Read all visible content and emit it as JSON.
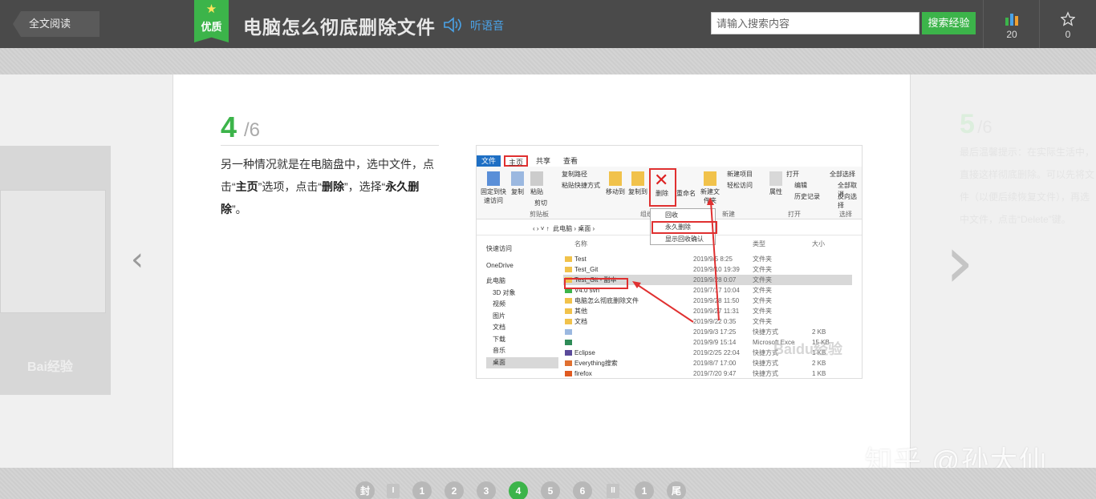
{
  "header": {
    "back_label": "全文阅读",
    "badge_label": "优质",
    "title": "电脑怎么彻底删除文件",
    "listen_label": "听语音",
    "search_placeholder": "请输入搜索内容",
    "search_button": "搜索经验",
    "stats_count": "20",
    "favorites_count": "0",
    "accent_color": "#3cb44a"
  },
  "step": {
    "current": "4",
    "total": "/6",
    "text_parts": [
      "另一种情况就是在电脑盘中，选中文件，点击“",
      "主页",
      "”选项，点击“",
      "删除",
      "”，选择“",
      "永久删除",
      "”。"
    ]
  },
  "screenshot": {
    "tabs": [
      "文件",
      "主页",
      "共享",
      "查看"
    ],
    "ribbon_buttons": [
      "固定到快速访问",
      "复制",
      "粘贴",
      "移动到",
      "复制到",
      "删除",
      "重命名",
      "新建文件夹",
      "属性",
      "打开",
      "全部选择"
    ],
    "ribbon_small": [
      "复制路径",
      "粘贴快捷方式",
      "剪切",
      "新建项目",
      "轻松访问",
      "编辑",
      "历史记录",
      "全部取消",
      "反向选择"
    ],
    "ribbon_groups": [
      "剪贴板",
      "组织",
      "新建",
      "打开",
      "选择"
    ],
    "delete_menu": [
      "回收",
      "永久删除",
      "显示回收确认"
    ],
    "address": [
      "此电脑",
      "桌面"
    ],
    "nav_items": [
      "快速访问",
      "OneDrive",
      "此电脑",
      "3D 对象",
      "视频",
      "图片",
      "文档",
      "下载",
      "音乐",
      "桌面"
    ],
    "columns": [
      "名称",
      "类型",
      "大小"
    ],
    "files": [
      {
        "name": "Test",
        "date": "2019/9/5 8:25",
        "type": "文件夹",
        "size": ""
      },
      {
        "name": "Test_Git",
        "date": "2019/9/10 19:39",
        "type": "文件夹",
        "size": ""
      },
      {
        "name": "Test_Git - 副本",
        "date": "2019/9/28 0:07",
        "type": "文件夹",
        "size": ""
      },
      {
        "name": "V4.0 svn",
        "date": "2019/7/17 10:04",
        "type": "文件夹",
        "size": ""
      },
      {
        "name": "电脑怎么彻底删除文件",
        "date": "2019/9/28 11:50",
        "type": "文件夹",
        "size": ""
      },
      {
        "name": "其他",
        "date": "2019/9/27 11:31",
        "type": "文件夹",
        "size": ""
      },
      {
        "name": "文档",
        "date": "2019/9/22 0:35",
        "type": "文件夹",
        "size": ""
      },
      {
        "name": "",
        "date": "2019/9/3 17:25",
        "type": "快捷方式",
        "size": "2 KB"
      },
      {
        "name": "",
        "date": "2019/9/9 15:14",
        "type": "Microsoft Exce",
        "size": "15 KB"
      },
      {
        "name": "Eclipse",
        "date": "2019/2/25 22:04",
        "type": "快捷方式",
        "size": "1 KB"
      },
      {
        "name": "Everything搜索",
        "date": "2019/8/7 17:00",
        "type": "快捷方式",
        "size": "2 KB"
      },
      {
        "name": "firefox",
        "date": "2019/7/20 9:47",
        "type": "快捷方式",
        "size": "1 KB"
      }
    ],
    "watermark": "Baidu经验"
  },
  "next_preview": {
    "number": "5",
    "total": "/6",
    "text": "最后温馨提示：在实际生活中，直接这样彻底删除。可以先将文件（以便后续恢复文件），再选中文件，点击“Delete”键。"
  },
  "prev_preview": {
    "watermark": "Bai经验"
  },
  "watermark": "知乎 @孙大仙",
  "pager": [
    {
      "label": "封",
      "kind": "round"
    },
    {
      "label": "I",
      "kind": "roman"
    },
    {
      "label": "1",
      "kind": "round"
    },
    {
      "label": "2",
      "kind": "round"
    },
    {
      "label": "3",
      "kind": "round"
    },
    {
      "label": "4",
      "kind": "active"
    },
    {
      "label": "5",
      "kind": "round"
    },
    {
      "label": "6",
      "kind": "round"
    },
    {
      "label": "II",
      "kind": "roman"
    },
    {
      "label": "1",
      "kind": "round"
    },
    {
      "label": "尾",
      "kind": "round"
    }
  ]
}
